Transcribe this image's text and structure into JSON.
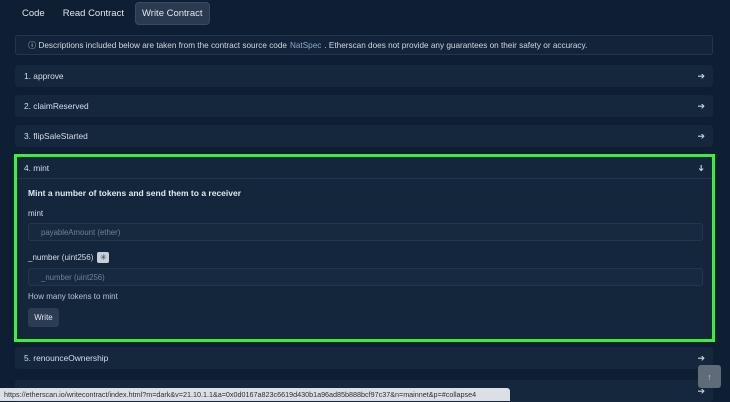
{
  "tabs": [
    "Code",
    "Read Contract",
    "Write Contract"
  ],
  "notice": {
    "icon": "info-icon",
    "text_before": "Descriptions included below are taken from the contract source code",
    "link": "NatSpec",
    "text_after": ". Etherscan does not provide any guarantees on their safety or accuracy."
  },
  "functions": [
    {
      "label": "1. approve",
      "icon": "arrow-right-icon"
    },
    {
      "label": "2. claimReserved",
      "icon": "arrow-right-icon"
    },
    {
      "label": "3. flipSaleStarted",
      "icon": "arrow-right-icon"
    }
  ],
  "mint": {
    "label": "4. mint",
    "icon": "arrow-down-icon",
    "description": "Mint a number of tokens and send them to a receiver",
    "param1_label": "mint",
    "param1_placeholder": "payableAmount (ether)",
    "param2_label": "_number (uint256)",
    "param2_button_icon": "plus-asterisk-icon",
    "param2_placeholder": "_number (uint256)",
    "hint": "How many tokens to mint",
    "write_label": "Write"
  },
  "function5": {
    "label": "5. renounceOwnership",
    "icon": "arrow-right-icon"
  },
  "function6_icon": "arrow-right-icon",
  "status_url": "https://etherscan.io/writecontract/index.html?m=dark&v=21.10.1.1&a=0x0d0167a823c6619d430b1a96ad85b888bcf97c37&n=mainnet&p=#collapse4",
  "scroll_top_icon": "arrow-up-icon",
  "highlight_color": "#3bf03b"
}
